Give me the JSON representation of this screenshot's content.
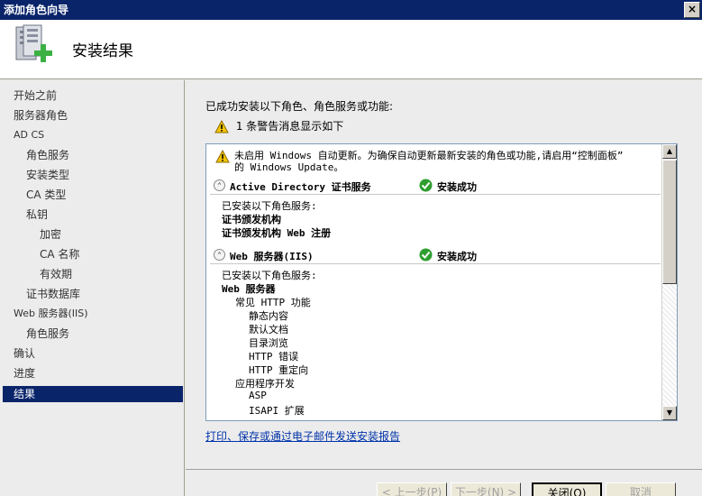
{
  "window": {
    "title": "添加角色向导",
    "close_glyph": "×"
  },
  "header": {
    "title": "安装结果",
    "icon": "server-add-icon"
  },
  "sidebar": {
    "items": [
      {
        "label": "开始之前"
      },
      {
        "label": "服务器角色"
      },
      {
        "label": "AD CS"
      },
      {
        "label": "角色服务"
      },
      {
        "label": "安装类型"
      },
      {
        "label": "CA 类型"
      },
      {
        "label": "私钥"
      },
      {
        "label": "加密"
      },
      {
        "label": "CA 名称"
      },
      {
        "label": "有效期"
      },
      {
        "label": "证书数据库"
      },
      {
        "label": "Web 服务器(IIS)"
      },
      {
        "label": "角色服务"
      },
      {
        "label": "确认"
      },
      {
        "label": "进度"
      },
      {
        "label": "结果"
      }
    ]
  },
  "main": {
    "intro": "已成功安装以下角色、角色服务或功能:",
    "warning_summary": "1 条警告消息显示如下",
    "results": {
      "warning_line1": "未启用 Windows 自动更新。为确保自动更新最新安装的角色或功能,请启用“控制面板”",
      "warning_line2": "的 Windows Update。",
      "sections": [
        {
          "name": "Active Directory 证书服务",
          "status": "安装成功",
          "services_label": "已安装以下角色服务:",
          "services": [
            "证书颁发机构",
            "证书颁发机构 Web 注册"
          ]
        },
        {
          "name": "Web 服务器(IIS)",
          "status": "安装成功",
          "services_label": "已安装以下角色服务:",
          "tree": [
            {
              "text": "Web 服务器",
              "level": 0,
              "bold": true
            },
            {
              "text": "常见 HTTP 功能",
              "level": 1
            },
            {
              "text": "静态内容",
              "level": 2
            },
            {
              "text": "默认文档",
              "level": 2
            },
            {
              "text": "目录浏览",
              "level": 2
            },
            {
              "text": "HTTP 错误",
              "level": 2
            },
            {
              "text": "HTTP 重定向",
              "level": 2
            },
            {
              "text": "应用程序开发",
              "level": 1
            },
            {
              "text": "ASP",
              "level": 2
            },
            {
              "text": "ISAPI 扩展",
              "level": 2
            }
          ]
        }
      ]
    },
    "report_link": "打印、保存或通过电子邮件发送安装报告"
  },
  "footer": {
    "prev": "< 上一步(P)",
    "next": "下一步(N) >",
    "close": "关闭(O)",
    "cancel": "取消"
  },
  "colors": {
    "selected_bg": "#0a246a",
    "link": "#0033aa",
    "success": "#2e9e2e",
    "warning": "#f5c400"
  }
}
